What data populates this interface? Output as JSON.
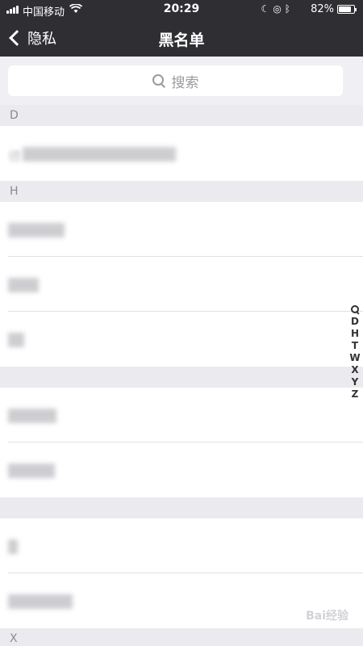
{
  "status_bar": {
    "carrier": "中国移动",
    "time": "20:29",
    "battery_percent": "82%",
    "battery_level": 0.82,
    "icons": [
      "moon-icon",
      "orientation-lock-icon",
      "bluetooth-icon"
    ]
  },
  "nav": {
    "back_label": "隐私",
    "title": "黑名单"
  },
  "search": {
    "placeholder": "搜索"
  },
  "sections": [
    {
      "letter": "D",
      "rows": [
        {
          "name": "德"
        }
      ]
    },
    {
      "letter": "H",
      "rows": [
        {
          "name": ""
        },
        {
          "name": ""
        },
        {
          "name": ""
        }
      ]
    },
    {
      "letter": "",
      "rows": [
        {
          "name": ""
        },
        {
          "name": ""
        }
      ]
    },
    {
      "letter": "",
      "rows": [
        {
          "name": ""
        },
        {
          "name": ""
        }
      ]
    },
    {
      "letter": "X",
      "rows": []
    }
  ],
  "index_bar": [
    "D",
    "H",
    "T",
    "W",
    "X",
    "Y",
    "Z"
  ],
  "watermark": "Bai经验"
}
